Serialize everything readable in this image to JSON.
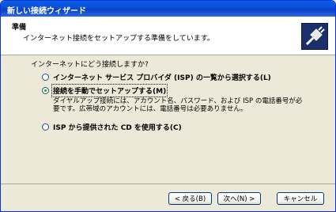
{
  "window": {
    "title": "新しい接続ウィザード"
  },
  "header": {
    "title": "準備",
    "subtitle": "インターネット接続をセットアップする準備をしています。"
  },
  "body": {
    "question": "インターネットにどう接続しますか?",
    "options": [
      {
        "label": "インターネット サービス プロバイダ (ISP) の一覧から選択する(L)",
        "selected": false
      },
      {
        "label": "接続を手動でセットアップする(M)",
        "selected": true,
        "description": "ダイヤルアップ接続には、アカウント名、パスワード、および ISP の電話番号が必要です。広帯域のアカウントには、電話番号は必要ありません。"
      },
      {
        "label": "ISP から提供された CD を使用する(C)",
        "selected": false
      }
    ]
  },
  "buttons": {
    "back": "< 戻る(B)",
    "next": "次へ(N) >",
    "cancel": "キャンセル"
  }
}
